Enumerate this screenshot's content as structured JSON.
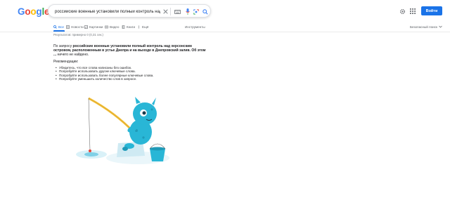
{
  "header": {
    "logo_letters": [
      "G",
      "o",
      "o",
      "g",
      "l",
      "e"
    ],
    "search": {
      "query": "российские военные установили полный контроль над херсо",
      "icons": [
        "close-icon",
        "keyboard-icon",
        "microphone-icon",
        "lens-icon",
        "search-icon"
      ]
    },
    "top_right": {
      "icons": [
        "gear-icon",
        "apps-grid-icon"
      ],
      "signin_label": "Войти"
    }
  },
  "tabs": [
    {
      "label": "Все",
      "icon": "search-icon",
      "active": true
    },
    {
      "label": "Новости",
      "icon": "news-icon",
      "active": false
    },
    {
      "label": "Картинки",
      "icon": "image-icon",
      "active": false
    },
    {
      "label": "Видео",
      "icon": "video-icon",
      "active": false
    },
    {
      "label": "Книги",
      "icon": "book-icon",
      "active": false
    },
    {
      "label": "Ещё",
      "icon": "more-icon",
      "active": false
    },
    {
      "label": "Инструменты",
      "icon": "",
      "active": false
    }
  ],
  "safesearch": {
    "label": "Безопасный поиск"
  },
  "results": {
    "stats": "Результатов: примерно 0 (0,31 сек.)",
    "message_prefix": "По запросу ",
    "message_query": "российские военные установили полный контроль над херсонским островом, расположенным в устье Днепра и на выходе в Днепровский залив. Об этом ...",
    "message_suffix": " ничего не найдено.",
    "recommendations_title": "Рекомендации:",
    "recommendations": [
      "Убедитесь, что все слова написаны без ошибок.",
      "Попробуйте использовать другие ключевые слова.",
      "Попробуйте использовать более популярные ключевые слова.",
      "Попробуйте уменьшить количество слов в запросе."
    ]
  },
  "colors": {
    "accent": "#1a73e8",
    "logo_blue": "#4285f4",
    "logo_red": "#ea4335",
    "logo_yellow": "#fbbc05",
    "logo_green": "#34a853",
    "mascot": "#29b6d6"
  }
}
